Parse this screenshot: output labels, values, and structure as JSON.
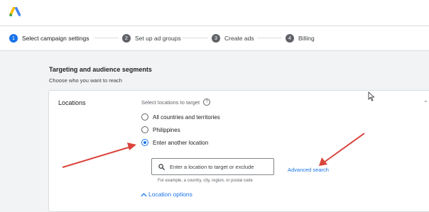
{
  "steps": [
    {
      "num": "1",
      "label": "Select campaign settings"
    },
    {
      "num": "2",
      "label": "Set up ad groups"
    },
    {
      "num": "3",
      "label": "Create ads"
    },
    {
      "num": "4",
      "label": "Billing"
    }
  ],
  "section": {
    "title": "Targeting and audience segments",
    "subtitle": "Choose who you want to reach"
  },
  "locations": {
    "label": "Locations",
    "select_label": "Select locations to target",
    "help_icon": "?",
    "options": [
      {
        "label": "All countries and territories",
        "checked": false
      },
      {
        "label": "Philippines",
        "checked": false
      },
      {
        "label": "Enter another location",
        "checked": true
      }
    ],
    "search_placeholder": "Enter a location to target or exclude",
    "search_hint": "For example, a country, city, region, or postal code",
    "advanced_search": "Advanced search",
    "location_options": "Location options"
  },
  "colors": {
    "accent": "#1a73e8",
    "annotation_arrow": "#d9453c"
  }
}
